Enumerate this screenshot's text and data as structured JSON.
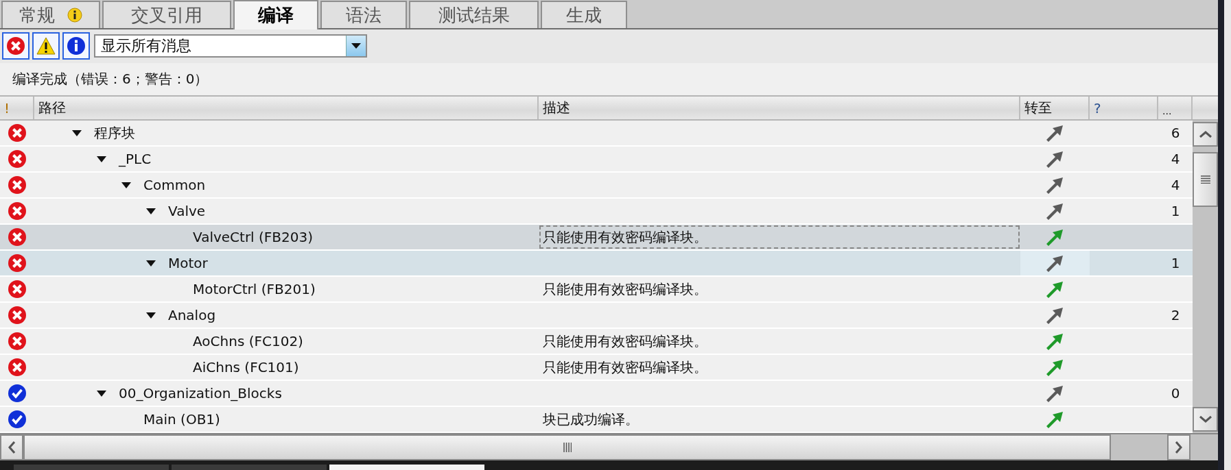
{
  "tabs": [
    {
      "label": "常规",
      "selected": false,
      "info": true
    },
    {
      "label": "交叉引用",
      "selected": false,
      "info": false
    },
    {
      "label": "编译",
      "selected": true,
      "info": false
    },
    {
      "label": "语法",
      "selected": false,
      "info": false
    },
    {
      "label": "测试结果",
      "selected": false,
      "info": false
    },
    {
      "label": "生成",
      "selected": false,
      "info": false
    }
  ],
  "filters": [
    {
      "kind": "error",
      "on": true
    },
    {
      "kind": "warning",
      "on": true
    },
    {
      "kind": "info",
      "on": true
    }
  ],
  "message_filter": {
    "value": "显示所有消息"
  },
  "status_text": "编译完成（错误：6；警告：0）",
  "bottom_tabs": [
    {
      "selected": false
    },
    {
      "selected": false
    },
    {
      "selected": true
    }
  ],
  "columns": [
    "!",
    "路径",
    "描述",
    "转至",
    "?",
    "..."
  ],
  "tree": [
    {
      "name": "程序块",
      "kind": "folder",
      "error": true,
      "expanded": true,
      "count": "6",
      "selected": false,
      "hovered": false,
      "children": [
        {
          "name": "_PLC",
          "kind": "folder",
          "error": true,
          "expanded": true,
          "count": "4",
          "selected": false,
          "hovered": false,
          "children": [
            {
              "name": "Common",
              "kind": "folder",
              "error": true,
              "expanded": true,
              "count": "4",
              "selected": false,
              "hovered": false,
              "children": [
                {
                  "name": "Valve",
                  "kind": "folder",
                  "error": true,
                  "expanded": true,
                  "count": "1",
                  "selected": false,
                  "hovered": false,
                  "children": [
                    {
                      "name": "ValveCtrl (FB203)",
                      "kind": "block",
                      "error": true,
                      "description": "只能使用有效密码编译块。",
                      "selected": true,
                      "hovered": false
                    }
                  ]
                },
                {
                  "name": "Motor",
                  "kind": "folder",
                  "error": true,
                  "expanded": true,
                  "count": "1",
                  "selected": false,
                  "hovered": true,
                  "children": [
                    {
                      "name": "MotorCtrl (FB201)",
                      "kind": "block",
                      "error": true,
                      "description": "只能使用有效密码编译块。",
                      "selected": false,
                      "hovered": false
                    }
                  ]
                },
                {
                  "name": "Analog",
                  "kind": "folder",
                  "error": true,
                  "expanded": true,
                  "count": "2",
                  "selected": false,
                  "hovered": false,
                  "children": [
                    {
                      "name": "AoChns (FC102)",
                      "kind": "block",
                      "error": true,
                      "description": "只能使用有效密码编译块。",
                      "selected": false,
                      "hovered": false
                    },
                    {
                      "name": "AiChns (FC101)",
                      "kind": "block",
                      "error": true,
                      "description": "只能使用有效密码编译块。",
                      "selected": false,
                      "hovered": false
                    }
                  ]
                }
              ]
            }
          ]
        },
        {
          "name": "00_Organization_Blocks",
          "kind": "folder",
          "error": false,
          "expanded": true,
          "count": "0",
          "selected": false,
          "hovered": false,
          "children": [
            {
              "name": "Main (OB1)",
              "kind": "block",
              "error": false,
              "description": "块已成功编译。",
              "selected": false,
              "hovered": false
            }
          ]
        }
      ]
    }
  ]
}
